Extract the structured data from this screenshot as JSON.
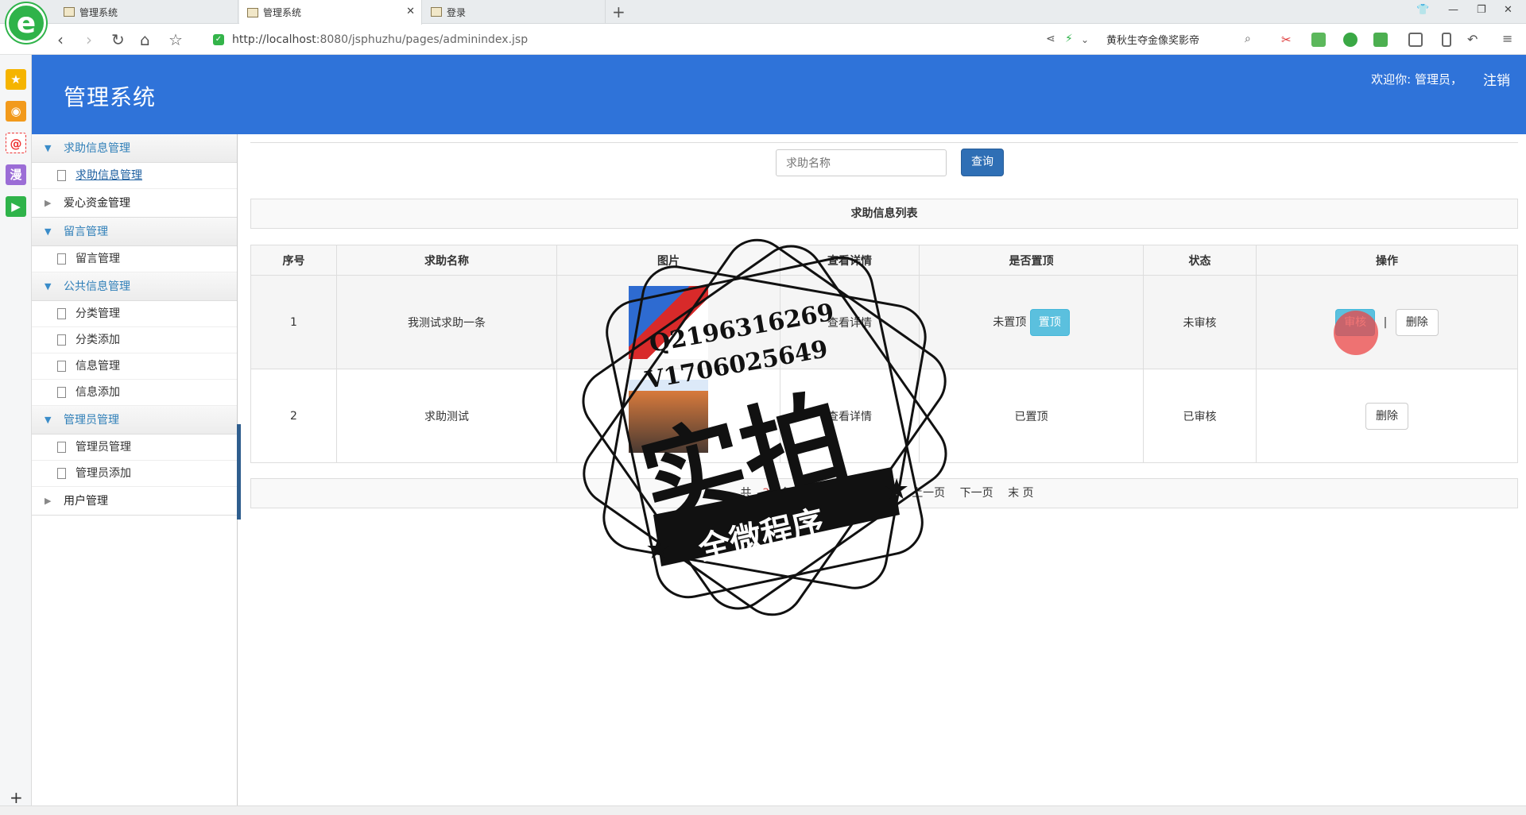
{
  "browser": {
    "tabs": [
      {
        "title": "管理系统",
        "active": false
      },
      {
        "title": "管理系统",
        "active": true
      },
      {
        "title": "登录",
        "active": false
      }
    ],
    "url_host": "http://localhost",
    "url_rest": ":8080/jsphuzhu/pages/adminindex.jsp",
    "search_text": "黄秋生夺金像奖影帝",
    "logo_letter": "e",
    "side_tools": [
      "star-icon",
      "weibo-icon",
      "mail-icon",
      "manga-icon",
      "video-icon"
    ],
    "side_tool_glyphs": {
      "star": "★",
      "weibo": "◉",
      "mail": "@",
      "manga": "漫",
      "video": "▶"
    }
  },
  "header": {
    "title": "管理系统",
    "welcome": "欢迎你: 管理员，",
    "logout": "注销"
  },
  "menu": {
    "groups": [
      {
        "title": "求助信息管理",
        "open": true,
        "items": [
          "求助信息管理"
        ]
      },
      {
        "title": "爱心资金管理",
        "open": false,
        "items": []
      },
      {
        "title": "留言管理",
        "open": true,
        "items": [
          "留言管理"
        ]
      },
      {
        "title": "公共信息管理",
        "open": true,
        "items": [
          "分类管理",
          "分类添加",
          "信息管理",
          "信息添加"
        ]
      },
      {
        "title": "管理员管理",
        "open": true,
        "items": [
          "管理员管理",
          "管理员添加"
        ]
      },
      {
        "title": "用户管理",
        "open": false,
        "items": []
      }
    ]
  },
  "search": {
    "placeholder": "求助名称",
    "button": "查询"
  },
  "list": {
    "caption": "求助信息列表",
    "columns": [
      "序号",
      "求助名称",
      "图片",
      "查看详情",
      "是否置顶",
      "状态",
      "操作"
    ],
    "rows": [
      {
        "index": "1",
        "name": "我测试求助一条",
        "detail": "查看详情",
        "top_status": "未置顶",
        "top_button": "置顶",
        "status": "未审核",
        "review_button": "审核",
        "separator": "|",
        "delete_button": "删除"
      },
      {
        "index": "2",
        "name": "求助测试",
        "detail": "查看详情",
        "top_status": "已置顶",
        "status": "已审核",
        "delete_button": "删除"
      }
    ]
  },
  "pager": {
    "total_prefix": "共",
    "total": "2",
    "total_suffix": "条记录",
    "per_page": "每页",
    "first": "首 页",
    "prev": "上一页",
    "next": "下一页",
    "last": "末 页"
  },
  "watermark": {
    "qq": "Q2196316269",
    "wechat": "V1706025649",
    "big": "实拍",
    "banner": "全微程序"
  },
  "colors": {
    "header_bg": "#2f73d9",
    "primary_btn": "#2f6fb5",
    "info_btn": "#5bc0de"
  }
}
